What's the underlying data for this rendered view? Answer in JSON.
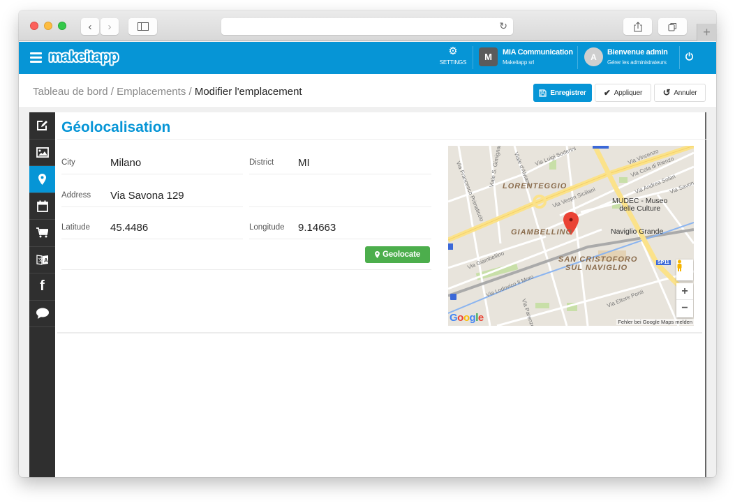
{
  "browser": {
    "url": "",
    "new_tab_label": "+"
  },
  "app": {
    "logo": "makeitapp",
    "settings_label": "SETTINGS",
    "company": {
      "initial": "M",
      "name": "MIA Communication",
      "subtitle": "Makeitapp srl"
    },
    "user": {
      "initial": "A",
      "greeting": "Bienvenue admin",
      "subtitle": "Gérer les administrateurs"
    },
    "colors": {
      "primary": "#0695d6",
      "success": "#4cae4c",
      "sidebar": "#2f2f2f"
    }
  },
  "breadcrumb": {
    "items": [
      "Tableau de bord",
      "Emplacements"
    ],
    "separator": " / ",
    "current": "Modifier l'emplacement"
  },
  "toolbar": {
    "save_label": "Enregistrer",
    "apply_label": "Appliquer",
    "cancel_label": "Annuler"
  },
  "sidenav": {
    "items": [
      {
        "icon": "edit-icon",
        "glyph": "✎",
        "active": false
      },
      {
        "icon": "image-icon",
        "glyph": "▨",
        "active": false
      },
      {
        "icon": "map-marker-icon",
        "glyph": "⬤",
        "active": true
      },
      {
        "icon": "calendar-icon",
        "glyph": "▦",
        "active": false
      },
      {
        "icon": "cart-icon",
        "glyph": "🛒",
        "active": false
      },
      {
        "icon": "translate-icon",
        "glyph": "文",
        "active": false
      },
      {
        "icon": "facebook-icon",
        "glyph": "f",
        "active": false
      },
      {
        "icon": "comment-icon",
        "glyph": "💬",
        "active": false
      }
    ]
  },
  "section": {
    "title": "Géolocalisation",
    "fields": {
      "city": {
        "label": "City",
        "value": "Milano"
      },
      "district": {
        "label": "District",
        "value": "MI"
      },
      "address": {
        "label": "Address",
        "value": "Via Savona 129"
      },
      "latitude": {
        "label": "Latitude",
        "value": "45.4486"
      },
      "longitude": {
        "label": "Longitude",
        "value": "9.14663"
      }
    },
    "geolocate_label": "Geolocate"
  },
  "map": {
    "areas": [
      "LORENTEGGIO",
      "GIAMBELLINO",
      "SAN CRISTOFORO",
      "SUL NAVIGLIO"
    ],
    "pois": [
      "MUDEC - Museo",
      "delle Culture",
      "Naviglio Grande"
    ],
    "streets": [
      "Via Francesco Primaticcio",
      "Viale S. Gimignano",
      "Via Luigi Soderini",
      "Via Vincenzo",
      "Via Cola di Rienzo",
      "Via Andrea Solari",
      "Via Savona",
      "Via Vespri Siciliani",
      "Via Giambellino",
      "Via Lodovico Il Moro",
      "Via Parenzo",
      "Via Ettore Ponti",
      "Viale d'Alviano"
    ],
    "road_badge": "SP11",
    "zoom_in": "+",
    "zoom_out": "−",
    "google": "Google",
    "report_label": "Fehler bei Google Maps melden"
  }
}
